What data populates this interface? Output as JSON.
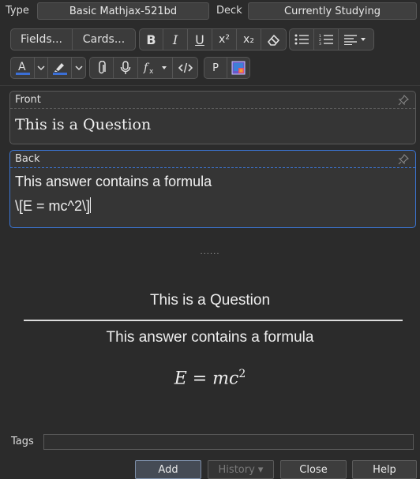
{
  "top": {
    "type_label": "Type",
    "note_type": "Basic Mathjax-521bd",
    "deck_label": "Deck",
    "deck": "Currently Studying"
  },
  "toolbar": {
    "fields_label": "Fields...",
    "cards_label": "Cards...",
    "bold_label": "B",
    "italic_label": "I",
    "underline_label": "U",
    "superscript_label": "x²",
    "subscript_label": "x₂",
    "p_label": "P",
    "text_color": "#3b6fd6",
    "highlight_color": "#3b6fd6"
  },
  "fields": {
    "front": {
      "name": "Front",
      "value": "This is a Question"
    },
    "back": {
      "name": "Back",
      "line1": "This answer contains a formula",
      "line2": "\\[E = mc^2\\]"
    }
  },
  "preview": {
    "separator": "......",
    "question": "This is a Question",
    "answer": "This answer contains a formula",
    "formula": "E = mc"
  },
  "tags": {
    "label": "Tags",
    "value": ""
  },
  "buttons": {
    "add": "Add",
    "history": "History ▾",
    "close": "Close",
    "help": "Help"
  }
}
